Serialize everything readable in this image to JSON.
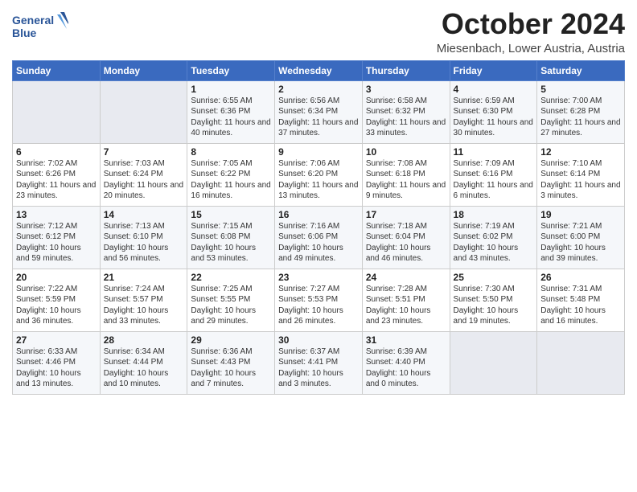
{
  "header": {
    "logo_line1": "General",
    "logo_line2": "Blue",
    "month_title": "October 2024",
    "location": "Miesenbach, Lower Austria, Austria"
  },
  "days_of_week": [
    "Sunday",
    "Monday",
    "Tuesday",
    "Wednesday",
    "Thursday",
    "Friday",
    "Saturday"
  ],
  "weeks": [
    [
      {
        "day": "",
        "sunrise": "",
        "sunset": "",
        "daylight": "",
        "empty": true
      },
      {
        "day": "",
        "sunrise": "",
        "sunset": "",
        "daylight": "",
        "empty": true
      },
      {
        "day": "1",
        "sunrise": "Sunrise: 6:55 AM",
        "sunset": "Sunset: 6:36 PM",
        "daylight": "Daylight: 11 hours and 40 minutes.",
        "empty": false
      },
      {
        "day": "2",
        "sunrise": "Sunrise: 6:56 AM",
        "sunset": "Sunset: 6:34 PM",
        "daylight": "Daylight: 11 hours and 37 minutes.",
        "empty": false
      },
      {
        "day": "3",
        "sunrise": "Sunrise: 6:58 AM",
        "sunset": "Sunset: 6:32 PM",
        "daylight": "Daylight: 11 hours and 33 minutes.",
        "empty": false
      },
      {
        "day": "4",
        "sunrise": "Sunrise: 6:59 AM",
        "sunset": "Sunset: 6:30 PM",
        "daylight": "Daylight: 11 hours and 30 minutes.",
        "empty": false
      },
      {
        "day": "5",
        "sunrise": "Sunrise: 7:00 AM",
        "sunset": "Sunset: 6:28 PM",
        "daylight": "Daylight: 11 hours and 27 minutes.",
        "empty": false
      }
    ],
    [
      {
        "day": "6",
        "sunrise": "Sunrise: 7:02 AM",
        "sunset": "Sunset: 6:26 PM",
        "daylight": "Daylight: 11 hours and 23 minutes.",
        "empty": false
      },
      {
        "day": "7",
        "sunrise": "Sunrise: 7:03 AM",
        "sunset": "Sunset: 6:24 PM",
        "daylight": "Daylight: 11 hours and 20 minutes.",
        "empty": false
      },
      {
        "day": "8",
        "sunrise": "Sunrise: 7:05 AM",
        "sunset": "Sunset: 6:22 PM",
        "daylight": "Daylight: 11 hours and 16 minutes.",
        "empty": false
      },
      {
        "day": "9",
        "sunrise": "Sunrise: 7:06 AM",
        "sunset": "Sunset: 6:20 PM",
        "daylight": "Daylight: 11 hours and 13 minutes.",
        "empty": false
      },
      {
        "day": "10",
        "sunrise": "Sunrise: 7:08 AM",
        "sunset": "Sunset: 6:18 PM",
        "daylight": "Daylight: 11 hours and 9 minutes.",
        "empty": false
      },
      {
        "day": "11",
        "sunrise": "Sunrise: 7:09 AM",
        "sunset": "Sunset: 6:16 PM",
        "daylight": "Daylight: 11 hours and 6 minutes.",
        "empty": false
      },
      {
        "day": "12",
        "sunrise": "Sunrise: 7:10 AM",
        "sunset": "Sunset: 6:14 PM",
        "daylight": "Daylight: 11 hours and 3 minutes.",
        "empty": false
      }
    ],
    [
      {
        "day": "13",
        "sunrise": "Sunrise: 7:12 AM",
        "sunset": "Sunset: 6:12 PM",
        "daylight": "Daylight: 10 hours and 59 minutes.",
        "empty": false
      },
      {
        "day": "14",
        "sunrise": "Sunrise: 7:13 AM",
        "sunset": "Sunset: 6:10 PM",
        "daylight": "Daylight: 10 hours and 56 minutes.",
        "empty": false
      },
      {
        "day": "15",
        "sunrise": "Sunrise: 7:15 AM",
        "sunset": "Sunset: 6:08 PM",
        "daylight": "Daylight: 10 hours and 53 minutes.",
        "empty": false
      },
      {
        "day": "16",
        "sunrise": "Sunrise: 7:16 AM",
        "sunset": "Sunset: 6:06 PM",
        "daylight": "Daylight: 10 hours and 49 minutes.",
        "empty": false
      },
      {
        "day": "17",
        "sunrise": "Sunrise: 7:18 AM",
        "sunset": "Sunset: 6:04 PM",
        "daylight": "Daylight: 10 hours and 46 minutes.",
        "empty": false
      },
      {
        "day": "18",
        "sunrise": "Sunrise: 7:19 AM",
        "sunset": "Sunset: 6:02 PM",
        "daylight": "Daylight: 10 hours and 43 minutes.",
        "empty": false
      },
      {
        "day": "19",
        "sunrise": "Sunrise: 7:21 AM",
        "sunset": "Sunset: 6:00 PM",
        "daylight": "Daylight: 10 hours and 39 minutes.",
        "empty": false
      }
    ],
    [
      {
        "day": "20",
        "sunrise": "Sunrise: 7:22 AM",
        "sunset": "Sunset: 5:59 PM",
        "daylight": "Daylight: 10 hours and 36 minutes.",
        "empty": false
      },
      {
        "day": "21",
        "sunrise": "Sunrise: 7:24 AM",
        "sunset": "Sunset: 5:57 PM",
        "daylight": "Daylight: 10 hours and 33 minutes.",
        "empty": false
      },
      {
        "day": "22",
        "sunrise": "Sunrise: 7:25 AM",
        "sunset": "Sunset: 5:55 PM",
        "daylight": "Daylight: 10 hours and 29 minutes.",
        "empty": false
      },
      {
        "day": "23",
        "sunrise": "Sunrise: 7:27 AM",
        "sunset": "Sunset: 5:53 PM",
        "daylight": "Daylight: 10 hours and 26 minutes.",
        "empty": false
      },
      {
        "day": "24",
        "sunrise": "Sunrise: 7:28 AM",
        "sunset": "Sunset: 5:51 PM",
        "daylight": "Daylight: 10 hours and 23 minutes.",
        "empty": false
      },
      {
        "day": "25",
        "sunrise": "Sunrise: 7:30 AM",
        "sunset": "Sunset: 5:50 PM",
        "daylight": "Daylight: 10 hours and 19 minutes.",
        "empty": false
      },
      {
        "day": "26",
        "sunrise": "Sunrise: 7:31 AM",
        "sunset": "Sunset: 5:48 PM",
        "daylight": "Daylight: 10 hours and 16 minutes.",
        "empty": false
      }
    ],
    [
      {
        "day": "27",
        "sunrise": "Sunrise: 6:33 AM",
        "sunset": "Sunset: 4:46 PM",
        "daylight": "Daylight: 10 hours and 13 minutes.",
        "empty": false
      },
      {
        "day": "28",
        "sunrise": "Sunrise: 6:34 AM",
        "sunset": "Sunset: 4:44 PM",
        "daylight": "Daylight: 10 hours and 10 minutes.",
        "empty": false
      },
      {
        "day": "29",
        "sunrise": "Sunrise: 6:36 AM",
        "sunset": "Sunset: 4:43 PM",
        "daylight": "Daylight: 10 hours and 7 minutes.",
        "empty": false
      },
      {
        "day": "30",
        "sunrise": "Sunrise: 6:37 AM",
        "sunset": "Sunset: 4:41 PM",
        "daylight": "Daylight: 10 hours and 3 minutes.",
        "empty": false
      },
      {
        "day": "31",
        "sunrise": "Sunrise: 6:39 AM",
        "sunset": "Sunset: 4:40 PM",
        "daylight": "Daylight: 10 hours and 0 minutes.",
        "empty": false
      },
      {
        "day": "",
        "sunrise": "",
        "sunset": "",
        "daylight": "",
        "empty": true
      },
      {
        "day": "",
        "sunrise": "",
        "sunset": "",
        "daylight": "",
        "empty": true
      }
    ]
  ]
}
